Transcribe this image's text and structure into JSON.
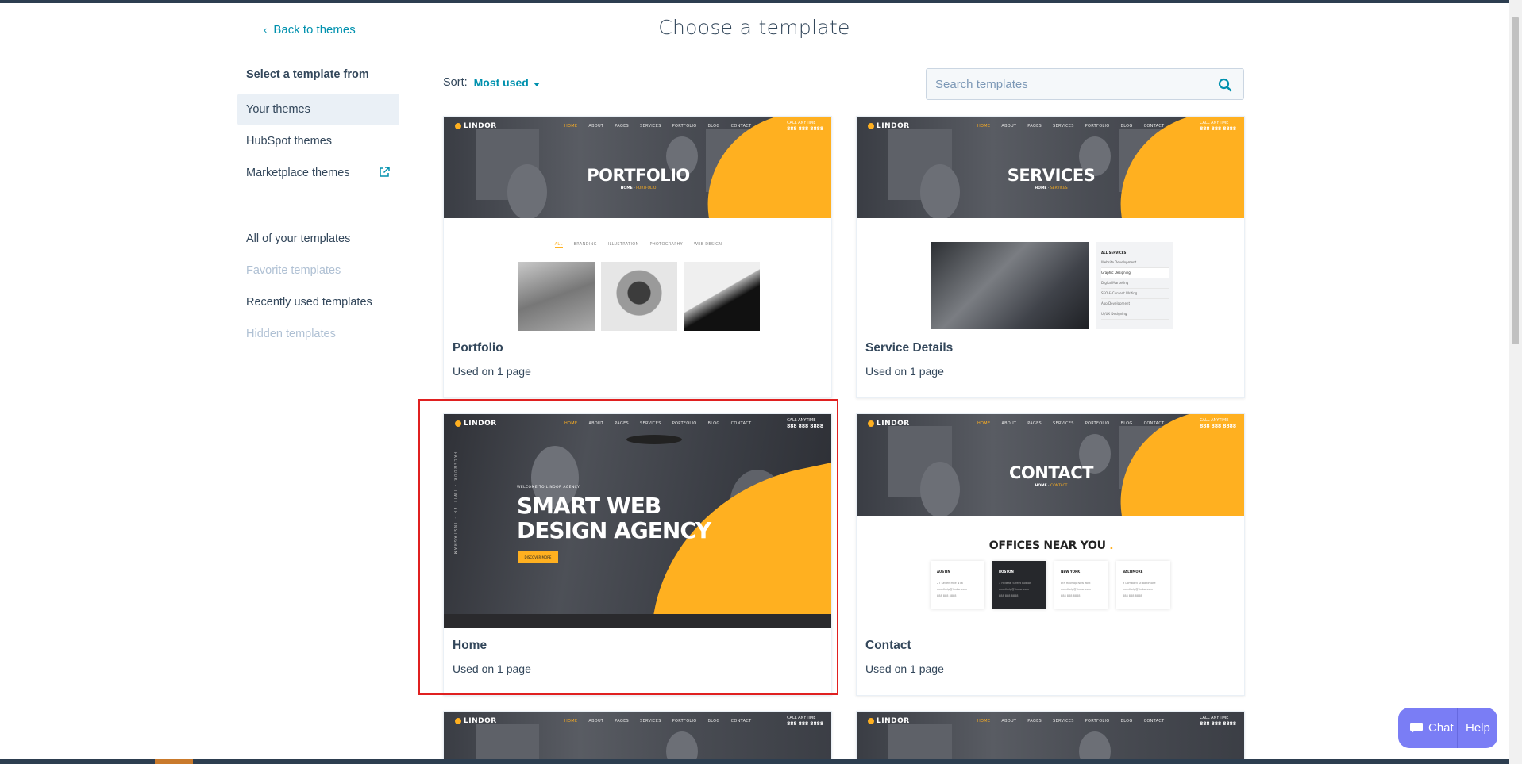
{
  "header": {
    "back_label": "Back to themes",
    "title": "Choose a template"
  },
  "sidebar": {
    "heading": "Select a template from",
    "sources": [
      {
        "label": "Your themes",
        "active": true
      },
      {
        "label": "HubSpot themes"
      },
      {
        "label": "Marketplace themes",
        "external": true
      }
    ],
    "filters": [
      {
        "label": "All of your templates"
      },
      {
        "label": "Favorite templates",
        "disabled": true
      },
      {
        "label": "Recently used templates"
      },
      {
        "label": "Hidden templates",
        "disabled": true
      }
    ]
  },
  "sort": {
    "label": "Sort:",
    "value": "Most used"
  },
  "search": {
    "placeholder": "Search templates"
  },
  "thumb_common": {
    "logo": "LINDOR",
    "nav": [
      "HOME",
      "ABOUT",
      "PAGES",
      "SERVICES",
      "PORTFOLIO",
      "BLOG",
      "CONTACT"
    ],
    "call_label": "CALL ANYTIME",
    "call_number": "888 888 8888"
  },
  "templates": [
    {
      "name": "Portfolio",
      "usage": "Used on 1 page",
      "hero_title": "PORTFOLIO",
      "crumb_home": "HOME",
      "crumb_page": "PORTFOLIO",
      "filters": [
        "ALL",
        "BRANDING",
        "ILLUSTRATION",
        "PHOTOGRAPHY",
        "WEB DESIGN"
      ]
    },
    {
      "name": "Service Details",
      "usage": "Used on 1 page",
      "hero_title": "SERVICES",
      "crumb_home": "HOME",
      "crumb_page": "SERVICES",
      "list_heading": "ALL SERVICES",
      "list": [
        "Website Development",
        "Graphic Designing",
        "Digital Marketing",
        "SEO & Content Writing",
        "App Development",
        "UI/UX Designing"
      ]
    },
    {
      "name": "Home",
      "usage": "Used on 1 page",
      "welcome": "WELCOME TO LINDOR AGENCY",
      "headline_1": "SMART WEB",
      "headline_2": "DESIGN AGENCY",
      "button": "DISCOVER MORE",
      "side_text": "FACEBOOK · TWITTER · INSTAGRAM"
    },
    {
      "name": "Contact",
      "usage": "Used on 1 page",
      "hero_title": "CONTACT",
      "crumb_home": "HOME",
      "crumb_page": "CONTACT",
      "offices_title": "OFFICES NEAR YOU",
      "offices": [
        {
          "city": "AUSTIN",
          "addr": "27 Seven Mile N76",
          "email": "needhelp@lindor.com",
          "phone": "888 888 8888"
        },
        {
          "city": "BOSTON",
          "addr": "3 Federal Street Boston",
          "email": "needhelp@lindor.com",
          "phone": "888 888 8888"
        },
        {
          "city": "NEW YORK",
          "addr": "8th Rooftop New York",
          "email": "needhelp@lindor.com",
          "phone": "888 888 8888"
        },
        {
          "city": "BALTIMORE",
          "addr": "3 Lombard St Baltimore",
          "email": "needhelp@lindor.com",
          "phone": "888 888 8888"
        }
      ]
    }
  ],
  "chat": {
    "chat_label": "Chat",
    "help_label": "Help"
  },
  "colors": {
    "accent": "#0091ae",
    "brand_yellow": "#ffb020",
    "highlight": "#e02020",
    "chat": "#7a7df5"
  }
}
